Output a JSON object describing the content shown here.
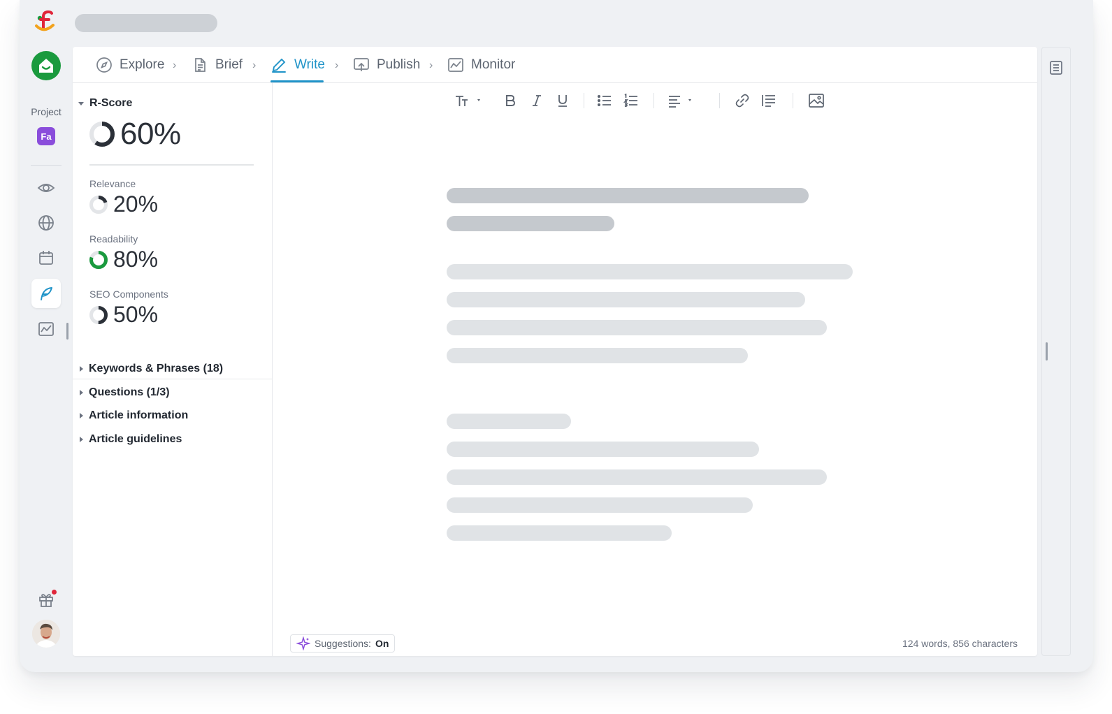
{
  "rail": {
    "project_label": "Project",
    "project_badge": "Fa"
  },
  "nav": {
    "items": [
      {
        "label": "Explore",
        "icon": "compass-icon"
      },
      {
        "label": "Brief",
        "icon": "document-icon"
      },
      {
        "label": "Write",
        "icon": "pen-icon",
        "active": true
      },
      {
        "label": "Publish",
        "icon": "upload-cloud-icon"
      },
      {
        "label": "Monitor",
        "icon": "chart-icon"
      }
    ]
  },
  "score": {
    "title": "R-Score",
    "value": "60%",
    "value_fraction": 0.6,
    "relevance": {
      "label": "Relevance",
      "value": "20%",
      "fraction": 0.2
    },
    "readability": {
      "label": "Readability",
      "value": "80%",
      "fraction": 0.8
    },
    "seo": {
      "label": "SEO Components",
      "value": "50%",
      "fraction": 0.5
    }
  },
  "sections": [
    {
      "label": "Keywords & Phrases (18)"
    },
    {
      "label": "Questions (1/3)"
    },
    {
      "label": "Article information"
    },
    {
      "label": "Article guidelines"
    }
  ],
  "toolbar": {
    "icons": [
      "text-size-icon",
      "bold-icon",
      "italic-icon",
      "underline-icon",
      "bullet-list-icon",
      "numbered-list-icon",
      "align-icon",
      "link-icon",
      "quote-icon",
      "image-icon"
    ]
  },
  "footer": {
    "suggestions_label": "Suggestions:",
    "suggestions_state": "On",
    "counter": "124 words, 856 characters"
  },
  "colors": {
    "accent": "#1f93c8",
    "brand_green": "#1a9a3e",
    "project_badge": "#8a4ddb",
    "score_dark": "#2b3038",
    "readability_green": "#1a9a3e"
  }
}
